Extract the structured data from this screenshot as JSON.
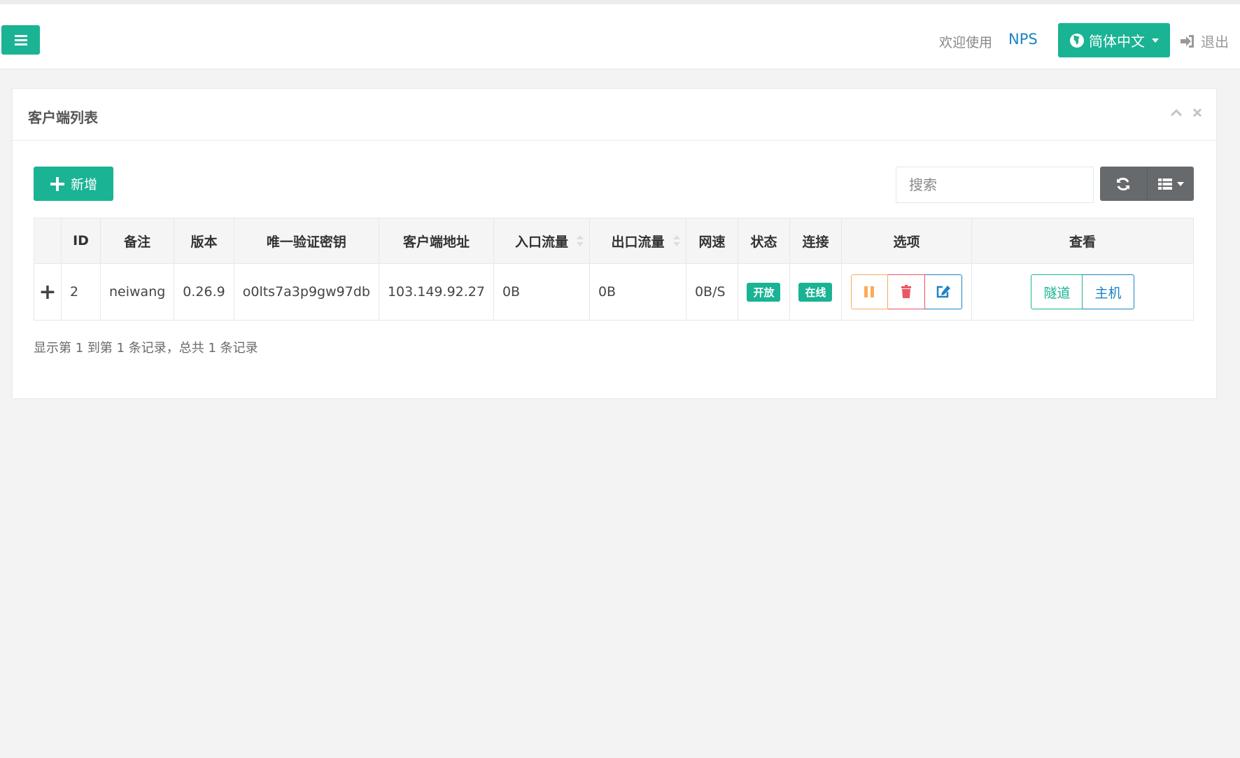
{
  "header": {
    "welcome": "欢迎使用",
    "brand": "NPS",
    "language": "简体中文",
    "logout": "退出",
    "menu_icon": "bars-icon"
  },
  "panel": {
    "title": "客户端列表",
    "add_label": "新增",
    "search_placeholder": "搜索",
    "columns": [
      "ID",
      "备注",
      "版本",
      "唯一验证密钥",
      "客户端地址",
      "入口流量",
      "出口流量",
      "网速",
      "状态",
      "连接",
      "选项",
      "查看"
    ],
    "rows": [
      {
        "expand": "+",
        "id": "2",
        "remark": "neiwang",
        "version": "0.26.9",
        "key": "o0lts7a3p9gw97db",
        "address": "103.149.92.27",
        "in_flow": "0B",
        "out_flow": "0B",
        "speed": "0B/S",
        "status": "开放",
        "connection": "在线",
        "view_tunnel": "隧道",
        "view_host": "主机"
      }
    ],
    "pagination": "显示第 1 到第 1 条记录，总共 1 条记录"
  },
  "colors": {
    "primary": "#1ab394",
    "info": "#1c84c6",
    "warning": "#f8ac59",
    "danger": "#ed5565",
    "tool_bg": "#676a6c"
  }
}
